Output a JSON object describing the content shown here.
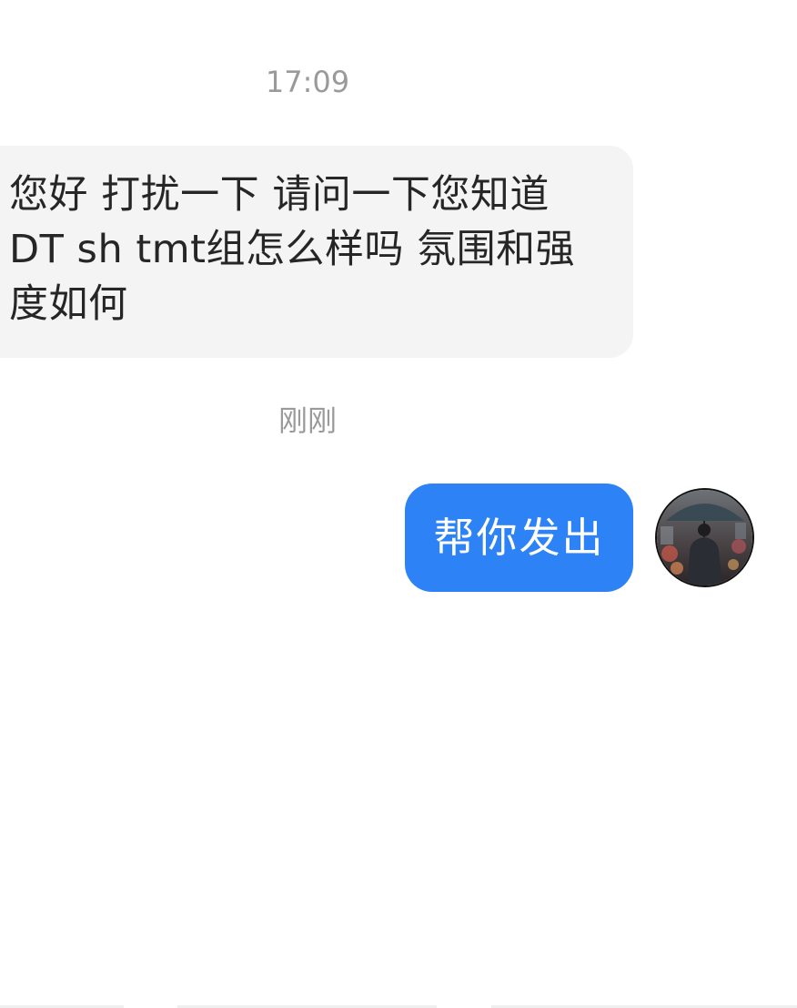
{
  "chat": {
    "messages": [
      {
        "timestamp": "17:09",
        "direction": "incoming",
        "text": "您好 打扰一下 请问一下您知道DT sh tmt组怎么样吗 氛围和强度如何"
      },
      {
        "timestamp": "刚刚",
        "direction": "outgoing",
        "text": "帮你发出"
      }
    ]
  },
  "colors": {
    "incoming_bubble": "#f4f4f4",
    "outgoing_bubble": "#2d83f5",
    "timestamp_text": "#9a9a9a"
  },
  "icons": {
    "avatar": "user-avatar-photo"
  }
}
